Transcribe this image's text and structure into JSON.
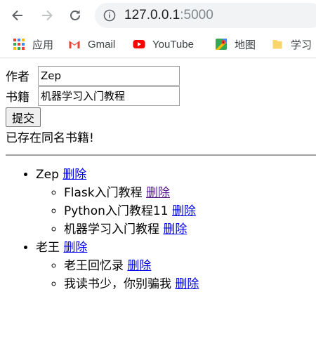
{
  "browser": {
    "url_host": "127.0.0.1",
    "url_port": ":5000"
  },
  "bookmarks": [
    {
      "label": "应用",
      "icon": "apps-grid-icon"
    },
    {
      "label": "Gmail",
      "icon": "gmail-icon"
    },
    {
      "label": "YouTube",
      "icon": "youtube-icon"
    },
    {
      "label": "地图",
      "icon": "maps-icon"
    },
    {
      "label": "学习",
      "icon": "folder-icon"
    }
  ],
  "form": {
    "author_label": "作者",
    "author_value": "Zep",
    "book_label": "书籍",
    "book_value": "机器学习入门教程",
    "submit_label": "提交"
  },
  "flash_message": "已存在同名书籍!",
  "delete_label": "删除",
  "authors": [
    {
      "name": "Zep",
      "books": [
        "Flask入门教程",
        "Python入门教程11",
        "机器学习入门教程"
      ]
    },
    {
      "name": "老王",
      "books": [
        "老王回忆录",
        "我读书少，你别骗我"
      ]
    }
  ]
}
